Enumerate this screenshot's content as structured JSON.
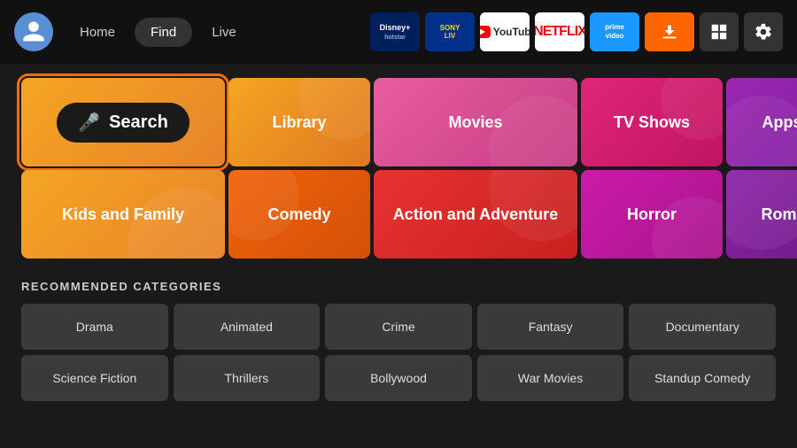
{
  "nav": {
    "home_label": "Home",
    "find_label": "Find",
    "live_label": "Live"
  },
  "apps": [
    {
      "name": "disney-plus",
      "label": "Disney+"
    },
    {
      "name": "sony-liv",
      "label": "SonyLIV"
    },
    {
      "name": "youtube",
      "label": "YouTube"
    },
    {
      "name": "netflix",
      "label": "NETFLIX"
    },
    {
      "name": "prime-video",
      "label": "prime video"
    },
    {
      "name": "downloader",
      "label": "Downloader"
    }
  ],
  "category_tiles": {
    "search": "Search",
    "library": "Library",
    "movies": "Movies",
    "tv_shows": "TV Shows",
    "appstore": "Appstore",
    "kids_family": "Kids and Family",
    "comedy": "Comedy",
    "action_adventure": "Action and Adventure",
    "horror": "Horror",
    "romance": "Romance"
  },
  "recommended": {
    "section_title": "RECOMMENDED CATEGORIES",
    "items": [
      "Drama",
      "Animated",
      "Crime",
      "Fantasy",
      "Documentary",
      "Science Fiction",
      "Thrillers",
      "Bollywood",
      "War Movies",
      "Standup Comedy"
    ]
  }
}
